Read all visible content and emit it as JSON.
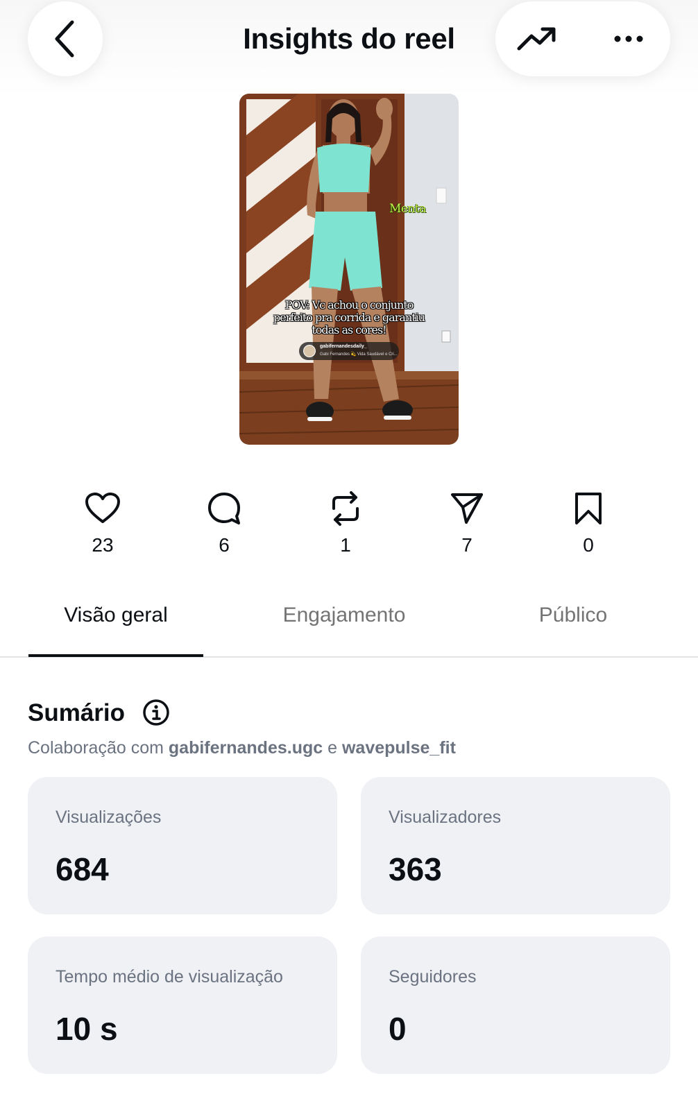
{
  "header": {
    "title": "Insights do reel",
    "back_icon": "chevron-left-icon",
    "trend_icon": "trending-up-icon",
    "more_icon": "more-horizontal-icon"
  },
  "reel": {
    "overlay_tag": "Menta",
    "caption": "POV: Vc achou o conjunto perfeito pra corrida e garantiu todas as cores!",
    "collab_user": "gabifernandesdaily_",
    "collab_sub": "Gabi Fernandes 💫 Vida Saudável e Cri..."
  },
  "stats": [
    {
      "icon": "heart-icon",
      "count": "23"
    },
    {
      "icon": "comment-icon",
      "count": "6"
    },
    {
      "icon": "repost-icon",
      "count": "1"
    },
    {
      "icon": "share-icon",
      "count": "7"
    },
    {
      "icon": "bookmark-icon",
      "count": "0"
    }
  ],
  "tabs": [
    {
      "label": "Visão geral",
      "active": true
    },
    {
      "label": "Engajamento",
      "active": false
    },
    {
      "label": "Público",
      "active": false
    }
  ],
  "summary": {
    "title": "Sumário",
    "collab_prefix": "Colaboração com",
    "collab_a": "gabifernandes.ugc",
    "collab_join": "e",
    "collab_b": "wavepulse_fit"
  },
  "cards": [
    {
      "label": "Visualizações",
      "value": "684"
    },
    {
      "label": "Visualizadores",
      "value": "363"
    },
    {
      "label": "Tempo médio de visualização",
      "value": "10 s"
    },
    {
      "label": "Seguidores",
      "value": "0"
    }
  ],
  "colors": {
    "text": "#0c1014",
    "muted": "#737373",
    "card_bg": "#eff1f5",
    "outfit": "#7fe3d2"
  }
}
